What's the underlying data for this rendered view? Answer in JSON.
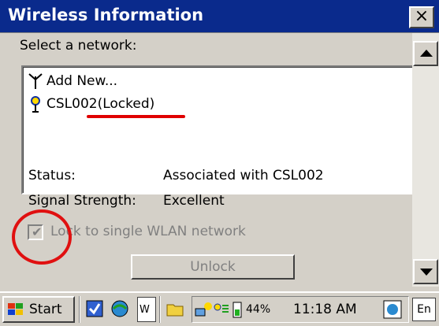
{
  "window": {
    "title": "Wireless Information",
    "close_glyph": "×"
  },
  "network": {
    "select_label": "Select a network:",
    "items": [
      {
        "label": "Add New...",
        "icon": "antenna-icon"
      },
      {
        "label": "CSL002(Locked)",
        "icon": "wireless-network-icon"
      }
    ]
  },
  "status": {
    "status_label": "Status:",
    "status_value": "Associated with CSL002",
    "signal_label": "Signal Strength:",
    "signal_value": "Excellent"
  },
  "lock": {
    "checkbox_label": "Lock to single WLAN network",
    "checked": true,
    "unlock_label": "Unlock"
  },
  "taskbar": {
    "start_label": "Start",
    "w_label": "W",
    "battery": "44%",
    "time": "11:18 AM",
    "kbd_label": "En"
  },
  "colors": {
    "title_bar": "#0a2a8c",
    "annotation": "#e01010"
  }
}
